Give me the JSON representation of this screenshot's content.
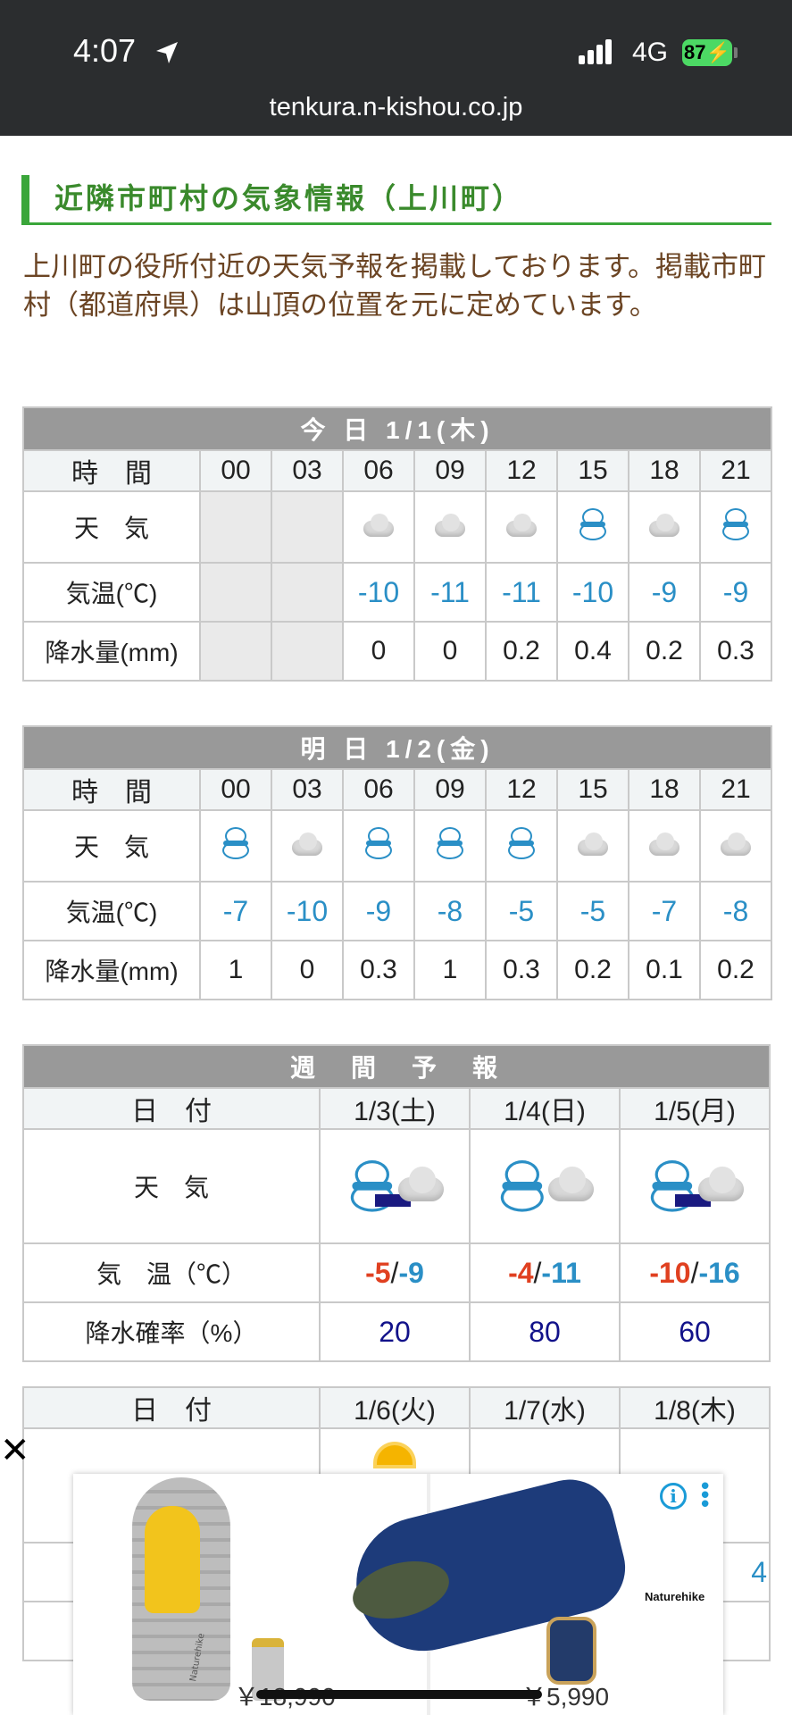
{
  "status": {
    "time": "4:07",
    "network": "4G",
    "battery": "87",
    "url": "tenkura.n-kishou.co.jp"
  },
  "heading": "近隣市町村の気象情報（上川町）",
  "intro": "上川町の役所付近の天気予報を掲載しております。掲載市町村（都道府県）は山頂の位置を元に定めています。",
  "labels": {
    "time": "時　間",
    "weather": "天　気",
    "temp": "気温(℃)",
    "precip": "降水量(mm)",
    "date": "日　付",
    "temp_week": "気　温（℃）",
    "prob": "降水確率（%）"
  },
  "hours": [
    "00",
    "03",
    "06",
    "09",
    "12",
    "15",
    "18",
    "21"
  ],
  "today": {
    "title": "今 日 1/1(木)",
    "weather": [
      "",
      "",
      "cloud-icon",
      "cloud-icon",
      "cloud-icon",
      "snow-icon",
      "cloud-icon",
      "snow-icon"
    ],
    "temp": [
      "",
      "",
      "-10",
      "-11",
      "-11",
      "-10",
      "-9",
      "-9"
    ],
    "precip": [
      "",
      "",
      "0",
      "0",
      "0.2",
      "0.4",
      "0.2",
      "0.3"
    ]
  },
  "tomorrow": {
    "title": "明 日 1/2(金)",
    "weather": [
      "snow-icon",
      "cloud-icon",
      "snow-icon",
      "snow-icon",
      "snow-icon",
      "cloud-icon",
      "cloud-icon",
      "cloud-icon"
    ],
    "temp": [
      "-7",
      "-10",
      "-9",
      "-8",
      "-5",
      "-5",
      "-7",
      "-8"
    ],
    "precip": [
      "1",
      "0",
      "0.3",
      "1",
      "0.3",
      "0.2",
      "0.1",
      "0.2"
    ]
  },
  "weekly": {
    "title": "週　間　予　報",
    "dates": [
      "1/3(土)",
      "1/4(日)",
      "1/5(月)"
    ],
    "weather": [
      "snow-then-cloud-icon",
      "snow-cloud-icon",
      "snow-then-cloud-icon"
    ],
    "hi": [
      "-5",
      "-4",
      "-10"
    ],
    "lo": [
      "-9",
      "-11",
      "-16"
    ],
    "prob": [
      "20",
      "80",
      "60"
    ]
  },
  "weekly2": {
    "dates": [
      "1/6(火)",
      "1/7(水)",
      "1/8(木)"
    ],
    "partial_value": "4"
  },
  "ad": {
    "price1": "￥18,990",
    "price2": "￥5,990",
    "brand": "Naturehike",
    "close": "✕",
    "info": "i",
    "label1": "Naturehike"
  },
  "colors": {
    "heading_green": "#3aa63a",
    "temp_blue": "#2a8fc6",
    "hi_red": "#e04020",
    "prob_navy": "#12128a"
  }
}
